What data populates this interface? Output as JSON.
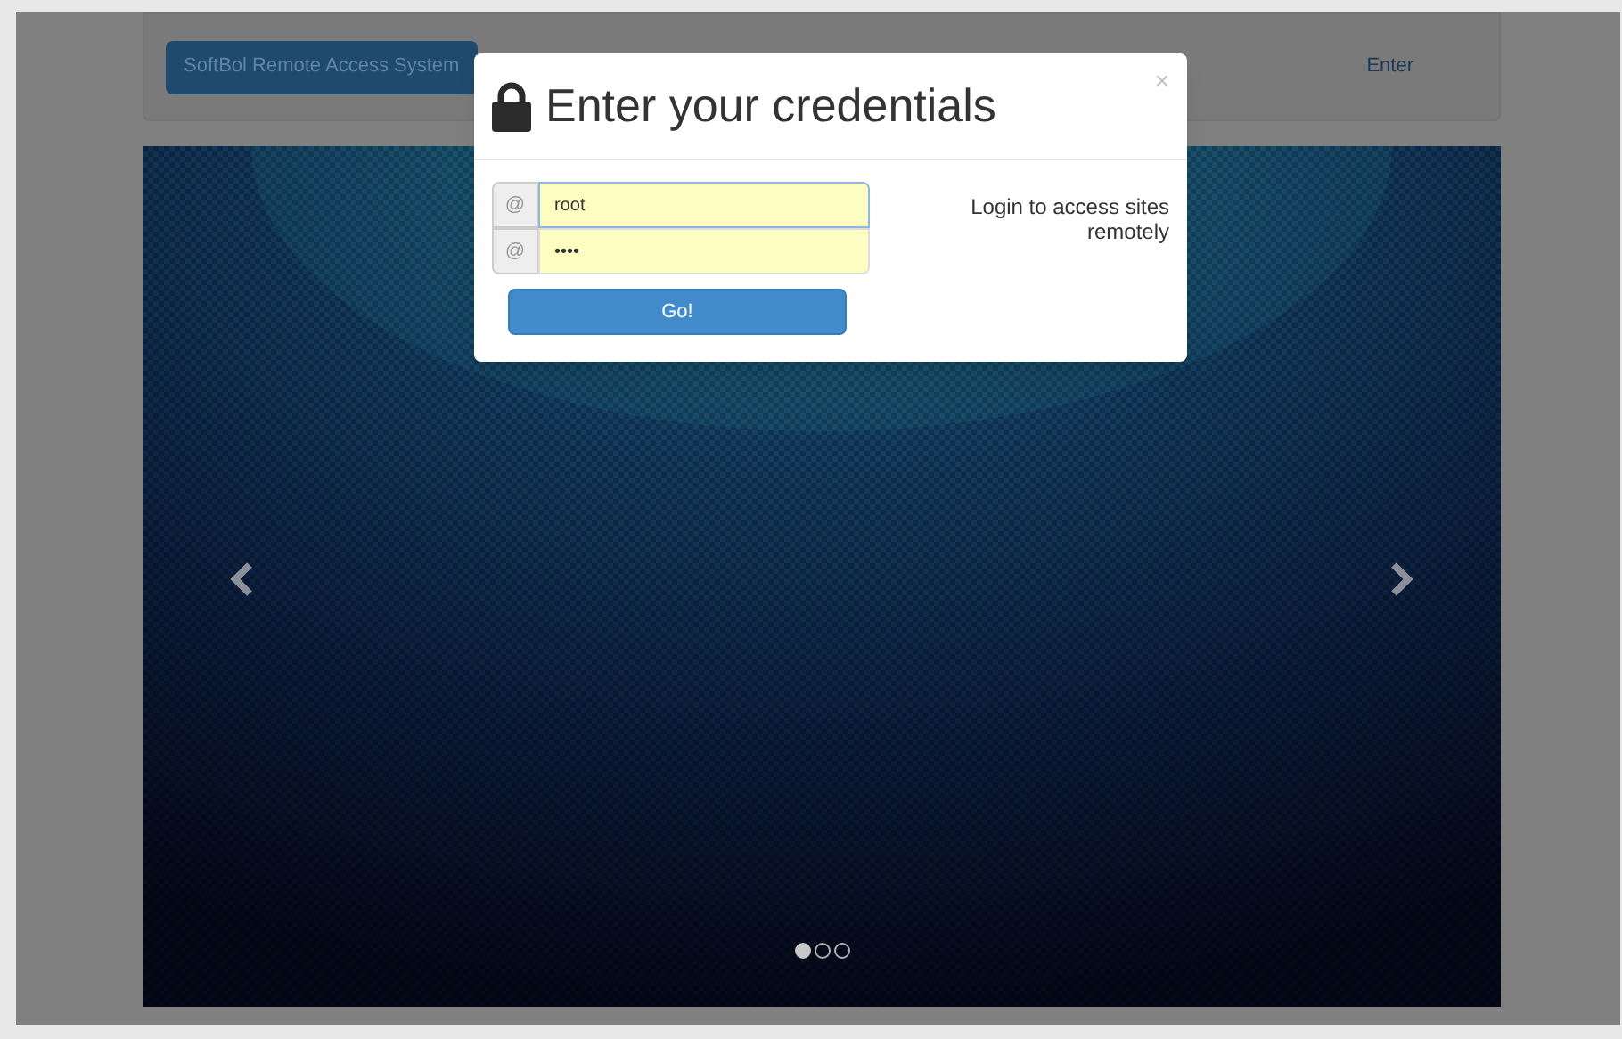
{
  "navbar": {
    "brand_button": "SoftBol Remote Access System",
    "link": "Enter"
  },
  "carousel": {
    "indicators": [
      {
        "selected": true
      },
      {
        "selected": false
      },
      {
        "selected": false
      }
    ]
  },
  "modal": {
    "title": "Enter your credentials",
    "close": "×",
    "fields": [
      {
        "addon": "@",
        "value": "root"
      },
      {
        "addon": "@",
        "value": "••••"
      }
    ],
    "submit": "Go!",
    "note": "Login to access sites remotely"
  }
}
